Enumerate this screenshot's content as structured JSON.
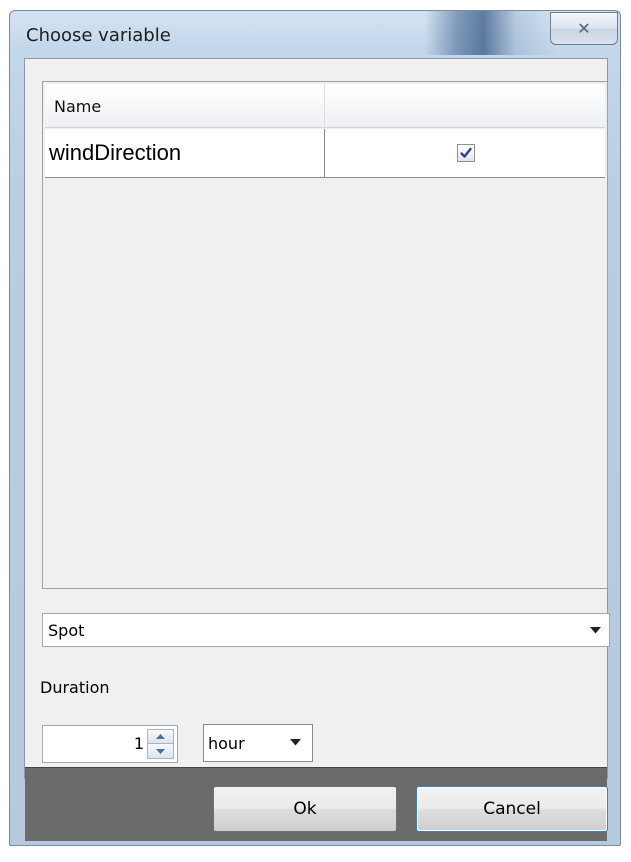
{
  "window": {
    "title": "Choose variable",
    "close_glyph": "✕"
  },
  "table": {
    "columns": [
      "Name",
      ""
    ],
    "rows": [
      {
        "name": "windDirection",
        "selected": true
      }
    ]
  },
  "mode_select": {
    "value": "Spot"
  },
  "duration": {
    "label": "Duration",
    "value": "1",
    "unit": "hour"
  },
  "buttons": {
    "ok": "Ok",
    "cancel": "Cancel"
  }
}
